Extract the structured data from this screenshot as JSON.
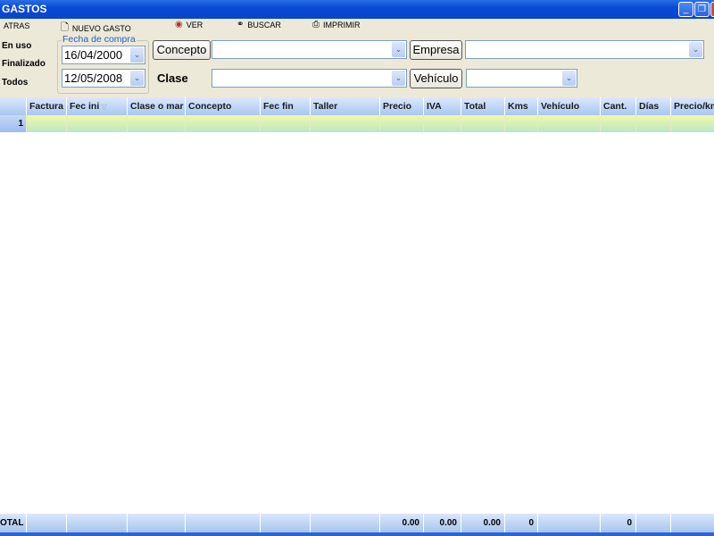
{
  "window": {
    "title": "GASTOS"
  },
  "toolbar": {
    "back": "ATRAS",
    "new": "NUEVO GASTO",
    "view": "VER",
    "search": "BUSCAR",
    "print": "IMPRIMIR"
  },
  "filters": {
    "status": [
      "En uso",
      "Finalizado",
      "Todos"
    ],
    "date_group": "Fecha de compra",
    "date_from": "16/04/2000",
    "date_to": "12/05/2008",
    "concepto_button": "Concepto",
    "concepto_value": "",
    "clase_label": "Clase",
    "clase_value": "",
    "empresa_button": "Empresa",
    "empresa_value": "",
    "vehiculo_button": "Vehículo",
    "vehiculo_value": ""
  },
  "grid": {
    "columns": [
      "º",
      "Factura",
      "Fec ini",
      "Clase o mar",
      "Concepto",
      "Fec fin",
      "Taller",
      "Precio",
      "IVA",
      "Total",
      "Kms",
      "Vehículo",
      "Cant.",
      "Días",
      "Precio/km"
    ],
    "sort_column": "Fec ini",
    "rows": [
      {
        "num": "1"
      }
    ],
    "footer": [
      "OTAL",
      "",
      "",
      "",
      "",
      "",
      "",
      "0.00",
      "0.00",
      "0.00",
      "0",
      "",
      "0",
      "",
      ""
    ]
  },
  "colors": {
    "titlebar": "#0a4ad6",
    "header": "#a9c6f3",
    "row": "#f4f8a8",
    "background": "#ece9d8"
  }
}
